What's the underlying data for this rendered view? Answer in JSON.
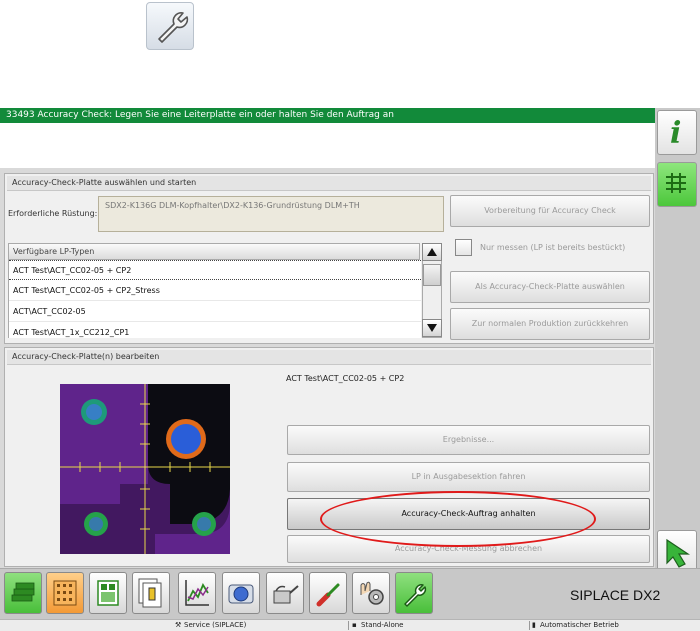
{
  "message_bar": {
    "text": "33493 Accuracy Check: Legen Sie eine Leiterplatte ein oder halten Sie den Auftrag an"
  },
  "panel_select": {
    "title": "Accuracy-Check-Platte auswählen und starten",
    "setup_label": "Erforderliche Rüstung:",
    "setup_value": "SDX2-K136G DLM-Kopfhalter\\DX2-K136-Grundrüstung DLM+TH",
    "list_header": "Verfügbare LP-Typen",
    "list_items": [
      "ACT Test\\ACT_CC02-05 + CP2",
      "ACT Test\\ACT_CC02-05 + CP2_Stress",
      "ACT\\ACT_CC02-05",
      "ACT Test\\ACT_1x_CC212_CP1"
    ],
    "btn_prepare": "Vorbereitung für Accuracy Check",
    "checkbox_label": "Nur messen (LP ist bereits bestückt)",
    "btn_select": "Als Accuracy-Check-Platte auswählen",
    "btn_normal": "Zur normalen Produktion zurückkehren"
  },
  "panel_edit": {
    "title": "Accuracy-Check-Platte(n) bearbeiten",
    "board_name": "ACT Test\\ACT_CC02-05 + CP2",
    "btn_results": "Ergebnisse...",
    "btn_eject": "LP in Ausgabesektion fahren",
    "btn_stop_order": "Accuracy-Check-Auftrag anhalten",
    "btn_abort": "Accuracy-Check-Messung abbrechen"
  },
  "taskbar": {
    "brand": "SIPLACE DX2",
    "icons": [
      "components-icon",
      "board-grid-icon",
      "layout-icon",
      "documents-icon",
      "chart-icon",
      "camera-icon",
      "oil-can-icon",
      "screwdriver-icon",
      "hand-gear-icon",
      "wrench-icon"
    ]
  },
  "statusbar": {
    "service": "Service (SIPLACE)",
    "mode": "Stand-Alone",
    "operation": "Automatischer Betrieb"
  },
  "colors": {
    "message_bar": "#128a3a",
    "highlight": "#e01a1a",
    "active_green": "#4cc73b"
  }
}
